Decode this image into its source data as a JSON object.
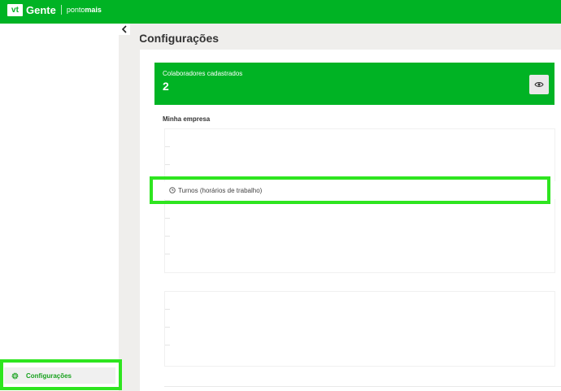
{
  "topbar": {
    "logo_mark": "vt",
    "logo_text": "Gente",
    "brand_light": "ponto",
    "brand_bold": "mais"
  },
  "main": {
    "title": "Configurações",
    "stat": {
      "label": "Colaboradores cadastrados",
      "value": "2"
    },
    "section_title": "Minha empresa",
    "turnos_label": "Turnos (horários de trabalho)"
  },
  "sidebar": {
    "config_label": "Configurações"
  },
  "colors": {
    "brand_green": "#00b324",
    "highlight": "#2ee51f",
    "background": "#efeeec"
  },
  "icons": [
    "chevron-left-icon",
    "eye-icon",
    "clock-icon",
    "gear-icon"
  ]
}
